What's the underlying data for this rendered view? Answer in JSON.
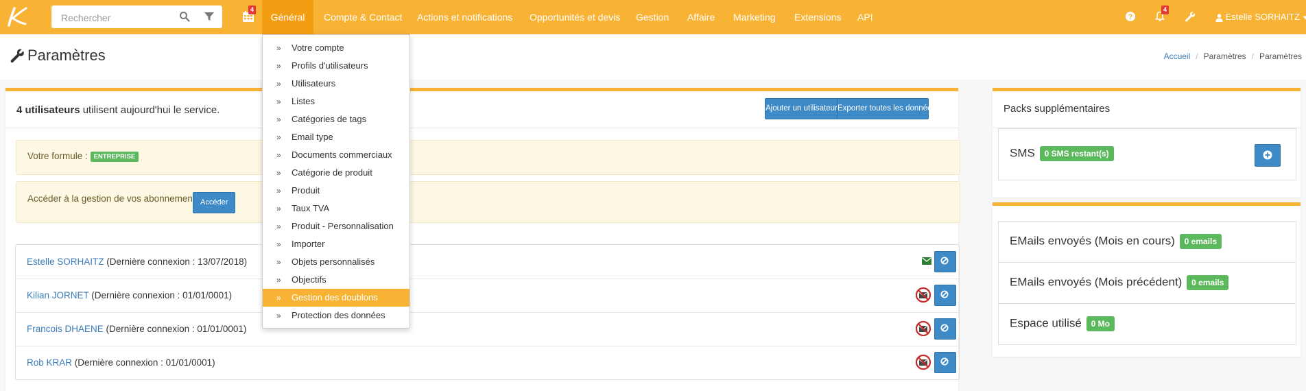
{
  "topbar": {
    "search_placeholder": "Rechercher",
    "calendar_badge": "4",
    "nav": [
      {
        "label": "Général"
      },
      {
        "label": "Compte & Contact"
      },
      {
        "label": "Actions et notifications"
      },
      {
        "label": "Opportunités et devis"
      },
      {
        "label": "Gestion"
      },
      {
        "label": "Affaire"
      },
      {
        "label": "Marketing"
      },
      {
        "label": "Extensions"
      },
      {
        "label": "API"
      }
    ],
    "notifications_badge": "4",
    "user_name": "Estelle SORHAITZ"
  },
  "dropdown": {
    "items": [
      {
        "label": "Votre compte"
      },
      {
        "label": "Profils d'utilisateurs"
      },
      {
        "label": "Utilisateurs"
      },
      {
        "label": "Listes"
      },
      {
        "label": "Catégories de tags"
      },
      {
        "label": "Email type"
      },
      {
        "label": "Documents commerciaux"
      },
      {
        "label": "Catégorie de produit"
      },
      {
        "label": "Produit"
      },
      {
        "label": "Taux TVA"
      },
      {
        "label": "Produit - Personnalisation"
      },
      {
        "label": "Importer"
      },
      {
        "label": "Objets personnalisés"
      },
      {
        "label": "Objectifs"
      },
      {
        "label": "Gestion des doublons"
      },
      {
        "label": "Protection des données"
      }
    ],
    "active_item": "Gestion des doublons"
  },
  "page": {
    "title": "Paramètres",
    "breadcrumb": [
      "Accueil",
      "Paramètres",
      "Paramètres"
    ]
  },
  "main": {
    "users_count": "4 utilisateurs",
    "users_text": " utilisent aujourd'hui le service.",
    "add_user_button": "Ajouter un utilisateur",
    "export_button": "Exporter toutes les données",
    "formula_label": "Votre formule :",
    "formula_badge": "ENTREPRISE",
    "subscription_text": "Accéder à la gestion de vos abonnements",
    "subscription_button": "Accéder",
    "users": [
      {
        "name": "Estelle SORHAITZ",
        "info": " (Dernière connexion : 13/07/2018)",
        "mail_status": "ok"
      },
      {
        "name": "Kilian JORNET",
        "info": " (Dernière connexion : 01/01/0001)",
        "mail_status": "blocked"
      },
      {
        "name": "Francois DHAENE",
        "info": " (Dernière connexion : 01/01/0001)",
        "mail_status": "blocked"
      },
      {
        "name": "Rob KRAR",
        "info": " (Dernière connexion : 01/01/0001)",
        "mail_status": "blocked"
      }
    ]
  },
  "side": {
    "packs_title": "Packs supplémentaires",
    "sms_label": "SMS",
    "sms_badge": "0 SMS restant(s)",
    "stats": [
      {
        "label": "EMails envoyés (Mois en cours)",
        "badge": "0 emails"
      },
      {
        "label": "EMails envoyés (Mois précédent)",
        "badge": "0 emails"
      },
      {
        "label": "Espace utilisé",
        "badge": "0 Mo"
      }
    ]
  },
  "colors": {
    "brand": "#f8b234",
    "brand_active": "#f39e12",
    "primary_button": "#3d8ac7",
    "success_label": "#5cb85c",
    "badge": "#e53935",
    "alert_bg": "#fcf8e3"
  }
}
